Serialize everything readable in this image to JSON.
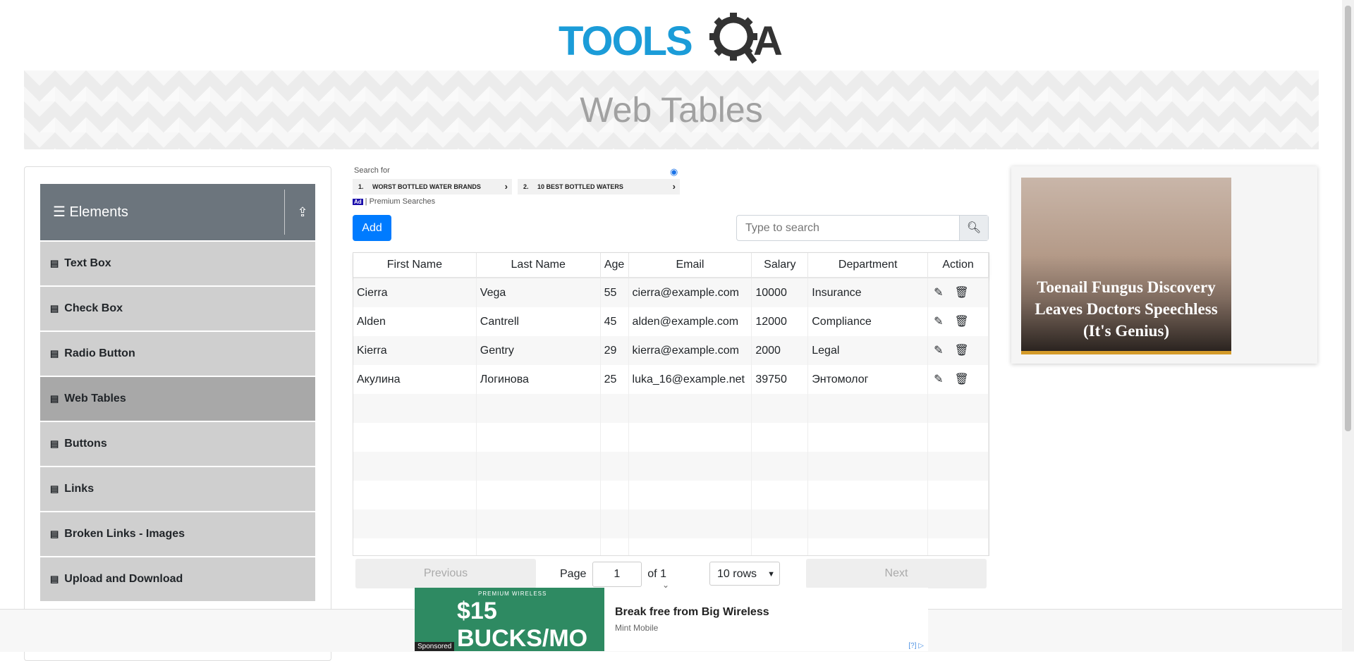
{
  "logo": {
    "text_left": "TOOLS",
    "text_right": "A",
    "colors": {
      "blue": "#1b9cd8",
      "dark": "#333333"
    }
  },
  "banner": {
    "title": "Web Tables"
  },
  "sidebar": {
    "group": {
      "title": "Elements",
      "icon": "hamburger-icon",
      "toggle_icon": "upload-icon"
    },
    "items": [
      {
        "label": "Text Box"
      },
      {
        "label": "Check Box"
      },
      {
        "label": "Radio Button"
      },
      {
        "label": "Web Tables",
        "active": true
      },
      {
        "label": "Buttons"
      },
      {
        "label": "Links"
      },
      {
        "label": "Broken Links - Images"
      },
      {
        "label": "Upload and Download"
      }
    ]
  },
  "search_ad": {
    "label": "Search for",
    "items": [
      {
        "num": "1.",
        "text": "WORST BOTTLED WATER BRANDS"
      },
      {
        "num": "2.",
        "text": "10 BEST BOTTLED WATERS"
      }
    ],
    "ad_badge": "Ad",
    "tag": "| Premium Searches"
  },
  "toolbar": {
    "add_label": "Add",
    "search_placeholder": "Type to search"
  },
  "table": {
    "headers": [
      "First Name",
      "Last Name",
      "Age",
      "Email",
      "Salary",
      "Department",
      "Action"
    ],
    "rows": [
      [
        "Cierra",
        "Vega",
        "55",
        "cierra@example.com",
        "10000",
        "Insurance"
      ],
      [
        "Alden",
        "Cantrell",
        "45",
        "alden@example.com",
        "12000",
        "Compliance"
      ],
      [
        "Kierra",
        "Gentry",
        "29",
        "kierra@example.com",
        "2000",
        "Legal"
      ],
      [
        "Акулина",
        "Логинова",
        "25",
        "luka_16@example.net",
        "39750",
        "Энтомолог"
      ]
    ],
    "empty_rows": 6
  },
  "pagination": {
    "previous": "Previous",
    "next": "Next",
    "page_label": "Page",
    "page_value": "1",
    "of_label": "of 1",
    "rows_option": "10 rows"
  },
  "right_ad": {
    "headline": "Toenail Fungus Discovery Leaves Doctors Speechless (It's Genius)"
  },
  "bottom_ad": {
    "image_top": "PREMIUM WIRELESS",
    "image_price": "$15 BUCKS/MO",
    "sponsored": "Sponsored",
    "headline": "Break free from Big Wireless",
    "source": "Mint Mobile",
    "info": "[?]"
  },
  "colors": {
    "primary": "#007bff",
    "sidebar_header": "#6c757d",
    "sidebar_item": "#cfcfcf",
    "sidebar_active": "#a8a8a8"
  }
}
